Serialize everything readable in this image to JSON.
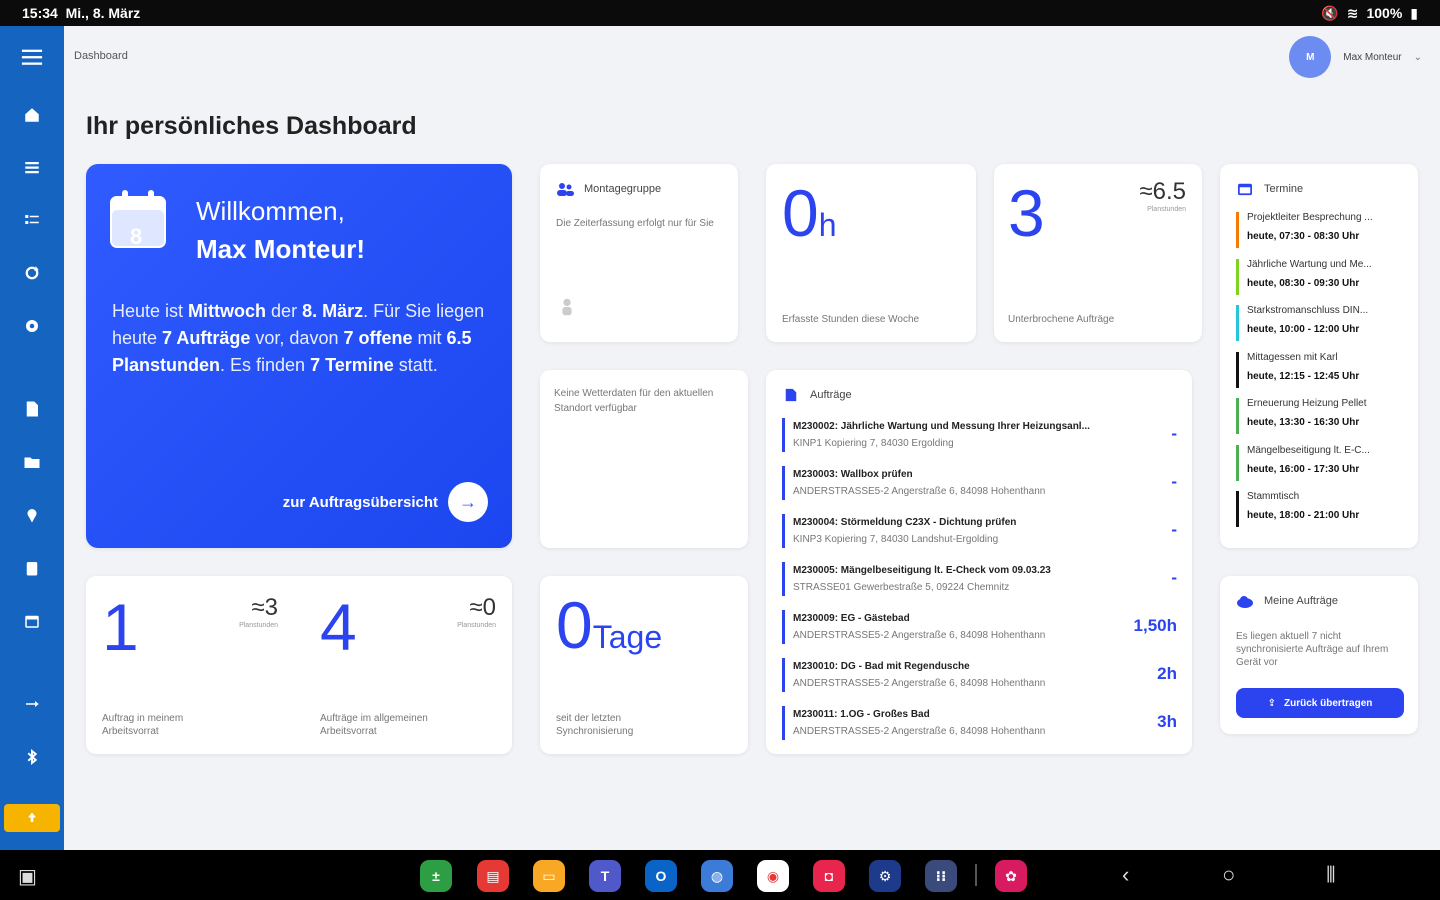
{
  "status": {
    "time": "15:34",
    "date": "Mi., 8. März",
    "battery": "100%"
  },
  "header": {
    "breadcrumb": "Dashboard",
    "user_initial": "M",
    "user_name": "Max Monteur",
    "page_title": "Ihr persönliches Dashboard"
  },
  "welcome": {
    "calendar_day": "8",
    "line1": "Willkommen,",
    "line2": "Max Monteur!",
    "p1": "Heute ist ",
    "weekday": "Mittwoch",
    "p2": " der ",
    "date": "8. März",
    "p3": ". Für Sie liegen heute ",
    "orders": "7 Aufträge",
    "p4": " vor, davon ",
    "open": "7 offene",
    "p5": " mit ",
    "hours": "6.5 Planstunden",
    "p6": ". Es finden ",
    "appts": "7 Termine",
    "p7": " statt.",
    "link": "zur Auftragsübersicht"
  },
  "montage": {
    "title": "Montagegruppe",
    "text": "Die Zeiterfassung erfolgt nur für Sie"
  },
  "hours_card": {
    "value": "0",
    "unit": "h",
    "label": "Erfasste Stunden diese Woche"
  },
  "unfinished": {
    "value": "3",
    "approx": "≈6.5",
    "sub": "Planstunden",
    "label": "Unterbrochene Aufträge"
  },
  "weather": {
    "text": "Keine Wetterdaten für den aktuellen Standort verfügbar"
  },
  "orders": {
    "title": "Aufträge",
    "items": [
      {
        "title": "M230002: Jährliche Wartung und Messung Ihrer Heizungsanl...",
        "address": "KINP1 Kopiering 7, 84030 Ergolding",
        "hours": "-"
      },
      {
        "title": "M230003: Wallbox prüfen",
        "address": "ANDERSTRASSE5-2 Angerstraße 6, 84098 Hohenthann",
        "hours": "-"
      },
      {
        "title": "M230004: Störmeldung C23X - Dichtung prüfen",
        "address": "KINP3 Kopiering 7, 84030 Landshut-Ergolding",
        "hours": "-"
      },
      {
        "title": "M230005: Mängelbeseitigung lt. E-Check vom 09.03.23",
        "address": "STRASSE01 Gewerbestraße 5, 09224 Chemnitz",
        "hours": "-"
      },
      {
        "title": "M230009: EG - Gästebad",
        "address": "ANDERSTRASSE5-2 Angerstraße 6, 84098 Hohenthann",
        "hours": "1,50h"
      },
      {
        "title": "M230010: DG - Bad mit Regendusche",
        "address": "ANDERSTRASSE5-2 Angerstraße 6, 84098 Hohenthann",
        "hours": "2h"
      },
      {
        "title": "M230011: 1.OG - Großes Bad",
        "address": "ANDERSTRASSE5-2 Angerstraße 6, 84098 Hohenthann",
        "hours": "3h"
      }
    ]
  },
  "appointments": {
    "title": "Termine",
    "items": [
      {
        "title": "Projektleiter Besprechung ...",
        "time": "heute, 07:30 - 08:30 Uhr",
        "color": "#f57c00"
      },
      {
        "title": "Jährliche Wartung und Me...",
        "time": "heute, 08:30 - 09:30 Uhr",
        "color": "#7ed321"
      },
      {
        "title": "Starkstromanschluss DIN...",
        "time": "heute, 10:00 - 12:00 Uhr",
        "color": "#26c6da"
      },
      {
        "title": "Mittagessen mit Karl",
        "time": "heute, 12:15 - 12:45 Uhr",
        "color": "#111111"
      },
      {
        "title": "Erneuerung Heizung Pellet",
        "time": "heute, 13:30 - 16:30 Uhr",
        "color": "#4caf50"
      },
      {
        "title": "Mängelbeseitigung lt. E-C...",
        "time": "heute, 16:00 - 17:30 Uhr",
        "color": "#4caf50"
      },
      {
        "title": "Stammtisch",
        "time": "heute, 18:00 - 21:00 Uhr",
        "color": "#111111"
      }
    ]
  },
  "my_area": {
    "value": "1",
    "approx": "≈3",
    "sub": "Planstunden",
    "label": "Auftrag in meinem Arbeitsvorrat"
  },
  "general_area": {
    "value": "4",
    "approx": "≈0",
    "sub": "Planstunden",
    "label": "Aufträge im allgemeinen Arbeitsvorrat"
  },
  "sync": {
    "value": "0",
    "unit": "Tage",
    "label": "seit der letzten Synchronisierung"
  },
  "my_orders": {
    "title": "Meine Aufträge",
    "text": "Es liegen aktuell 7 nicht synchronisierte Aufträge auf Ihrem Gerät vor",
    "button": "Zurück übertragen"
  },
  "colors": {
    "sidebar": "#1565c0",
    "accent": "#2b44ef",
    "badge": "#f6b400"
  }
}
